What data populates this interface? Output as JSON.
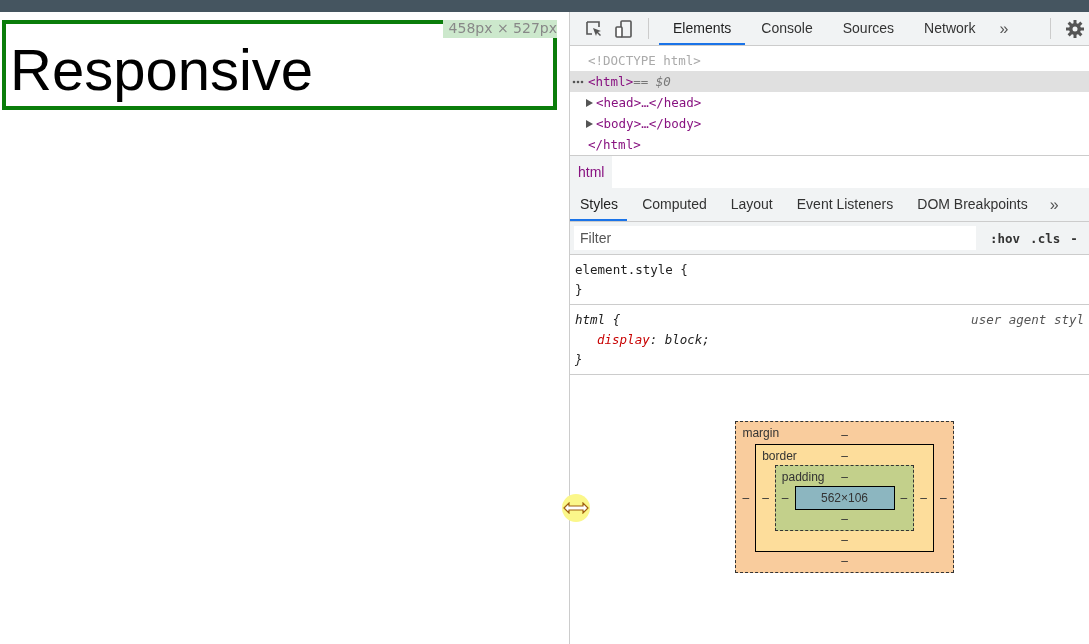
{
  "page": {
    "heading": "Responsive",
    "size_overlay": "458px × 527px"
  },
  "devtools": {
    "tabs": [
      {
        "label": "Elements",
        "selected": true
      },
      {
        "label": "Console",
        "selected": false
      },
      {
        "label": "Sources",
        "selected": false
      },
      {
        "label": "Network",
        "selected": false
      }
    ],
    "more_tabs": "»",
    "dom_tree": [
      {
        "kind": "doctype",
        "text": "<!DOCTYPE html>",
        "selected": false
      },
      {
        "kind": "tag",
        "text": "<html>",
        "suffix": " == $0",
        "selected": true
      },
      {
        "kind": "collapsed",
        "text": "<head>…</head>",
        "expanded": false,
        "selected": false
      },
      {
        "kind": "collapsed",
        "text": "<body>…</body>",
        "expanded": false,
        "selected": false
      },
      {
        "kind": "tag",
        "text": "</html>",
        "selected": false
      }
    ],
    "breadcrumb": "html",
    "sub_tabs": [
      {
        "label": "Styles",
        "selected": true
      },
      {
        "label": "Computed",
        "selected": false
      },
      {
        "label": "Layout",
        "selected": false
      },
      {
        "label": "Event Listeners",
        "selected": false
      },
      {
        "label": "DOM Breakpoints",
        "selected": false
      }
    ],
    "more_sub_tabs": "»",
    "filter": {
      "placeholder": "Filter"
    },
    "filter_buttons": [
      ":hov",
      ".cls",
      "-"
    ],
    "rules": [
      {
        "selector": "element.style {",
        "italic": false,
        "close": "}"
      },
      {
        "selector": "html {",
        "italic": true,
        "source": "user agent styl",
        "declarations": [
          {
            "property": "display",
            "separator": ":",
            "value": "block;"
          }
        ],
        "close": "}"
      }
    ],
    "box_model": {
      "margin": {
        "label": "margin",
        "top": "–",
        "left": "–",
        "right": "–",
        "bottom": "–"
      },
      "border": {
        "label": "border",
        "top": "–",
        "left": "–",
        "right": "–",
        "bottom": "–"
      },
      "padding": {
        "label": "padding",
        "top": "–",
        "left": "–",
        "right": "–",
        "bottom": "–"
      },
      "content": "562×106"
    }
  }
}
